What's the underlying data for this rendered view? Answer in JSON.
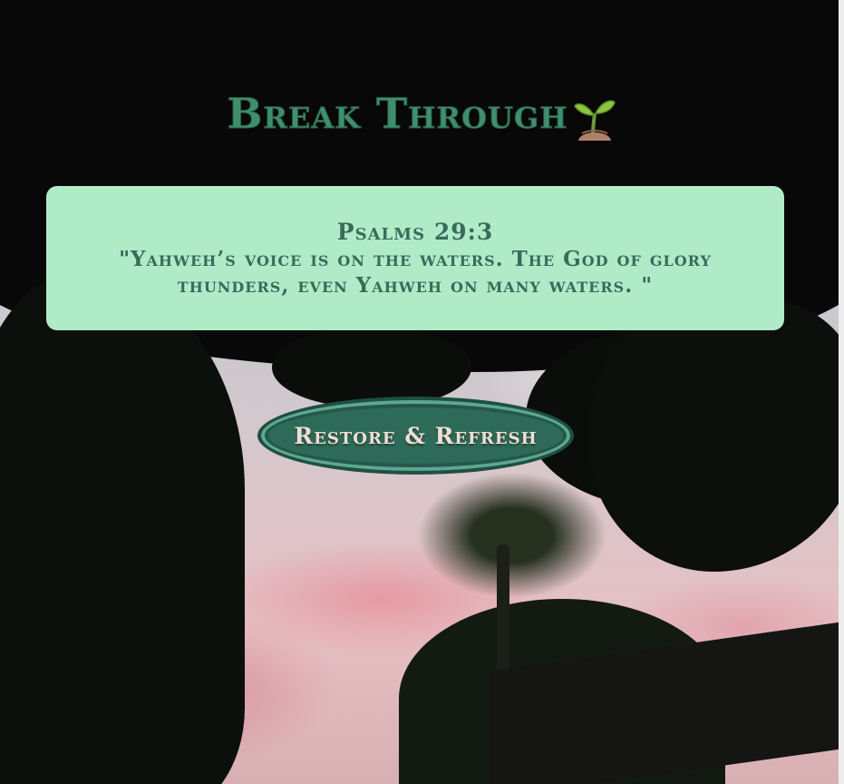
{
  "header": {
    "title": "Break Through",
    "title_icon": "seedling-icon"
  },
  "verse": {
    "reference": "Psalms 29:3",
    "text": "\"Yahweh’s voice is on the waters. The God of glory thunders, even Yahweh on many waters. \""
  },
  "actions": {
    "restore_label": "Restore & Refresh"
  },
  "colors": {
    "title": "#3f8f6e",
    "card_background": "#b0ebc8",
    "card_text": "#3a6a5a",
    "button_background": "#2e6a58",
    "button_text": "#f2ddd6"
  }
}
